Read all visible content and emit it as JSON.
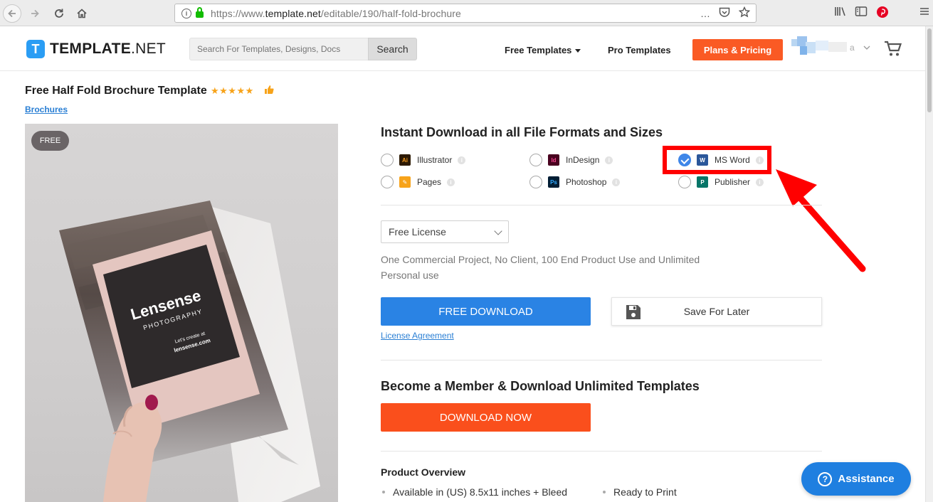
{
  "browser": {
    "url_prefix": "https://www.",
    "url_domain": "template.net",
    "url_path": "/editable/190/half-fold-brochure",
    "more_icon": "…"
  },
  "header": {
    "logo_letter": "T",
    "logo_bold": "TEMPLATE",
    "logo_rest": ".NET",
    "search_placeholder": "Search For Templates, Designs, Docs",
    "search_button": "Search",
    "nav_free": "Free Templates",
    "nav_pro": "Pro Templates",
    "plans_button": "Plans & Pricing",
    "user_initial": "a"
  },
  "product": {
    "title": "Free Half Fold Brochure Template",
    "stars": "★★★★★",
    "category": "Brochures",
    "badge": "FREE",
    "image_words": {
      "brand": "Lensense",
      "tagline": "PHOTOGRAPHY",
      "cta_line": "Let's create at",
      "site": "lensense.com"
    }
  },
  "download": {
    "heading": "Instant Download in all File Formats and Sizes",
    "formats": [
      {
        "label": "Illustrator",
        "abbr": "Ai",
        "checked": false
      },
      {
        "label": "InDesign",
        "abbr": "Id",
        "checked": false
      },
      {
        "label": "MS Word",
        "abbr": "W",
        "checked": true
      },
      {
        "label": "Pages",
        "abbr": "✎",
        "checked": false
      },
      {
        "label": "Photoshop",
        "abbr": "Ps",
        "checked": false
      },
      {
        "label": "Publisher",
        "abbr": "P",
        "checked": false
      }
    ],
    "license_select": "Free License",
    "license_desc": "One Commercial Project, No Client, 100 End Product Use and Unlimited Personal use",
    "free_button": "FREE DOWNLOAD",
    "save_button": "Save For Later",
    "license_link": "License Agreement"
  },
  "membership": {
    "heading": "Become a Member & Download Unlimited Templates",
    "button": "DOWNLOAD NOW"
  },
  "overview": {
    "heading": "Product Overview",
    "bullets": [
      "Available in (US) 8.5x11 inches + Bleed",
      "Ready to Print"
    ]
  },
  "assistance": {
    "label": "Assistance",
    "icon_glyph": "?"
  },
  "colors": {
    "brand_blue": "#2a83e4",
    "plans_orange": "#fa5a24",
    "download_orange": "#fa4f1c",
    "highlight_red": "#ff0000"
  }
}
